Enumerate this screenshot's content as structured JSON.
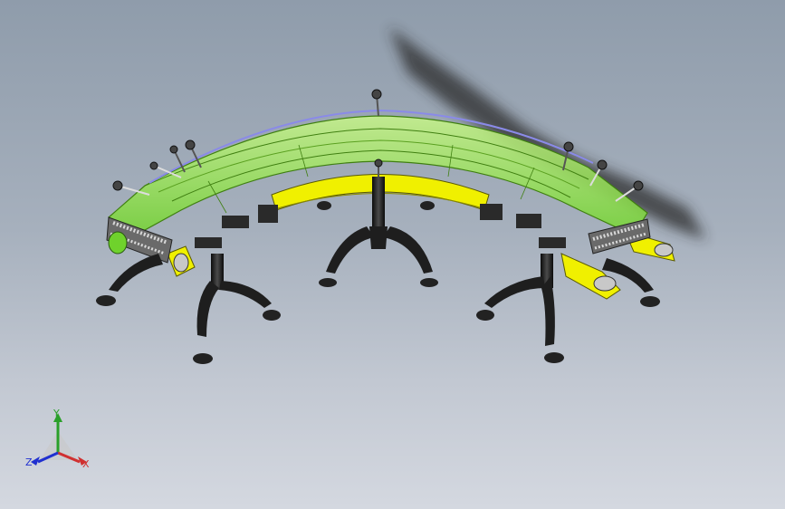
{
  "viewport": {
    "background_top": "#8f9cab",
    "background_bottom": "#d4d8e0"
  },
  "model": {
    "guard_color": "#9be84a",
    "belt_color": "#f0f000",
    "frame_color": "#2a2a2a",
    "feet_color": "#1e1e1e",
    "edge_color": "#8a8ae8"
  },
  "triad": {
    "y_label": "Y",
    "x_label": "X",
    "z_label": "Z",
    "y_color": "#2aa02a",
    "x_color": "#d03030",
    "z_color": "#2030d0"
  }
}
